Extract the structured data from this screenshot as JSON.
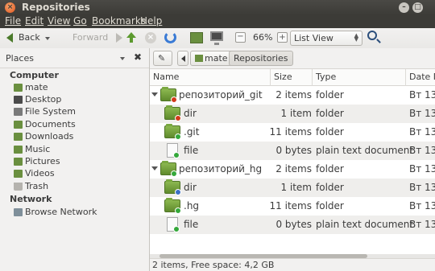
{
  "window": {
    "title": "Repositories"
  },
  "menu": [
    "File",
    "Edit",
    "View",
    "Go",
    "Bookmarks",
    "Help"
  ],
  "toolbar": {
    "back_label": "Back",
    "forward_label": "Forward",
    "zoom_level": "66%",
    "view_mode": "List View"
  },
  "sidebar": {
    "header": "Places",
    "sections": [
      {
        "title": "Computer",
        "items": [
          "mate",
          "Desktop",
          "File System",
          "Documents",
          "Downloads",
          "Music",
          "Pictures",
          "Videos",
          "Trash"
        ]
      },
      {
        "title": "Network",
        "items": [
          "Browse Network"
        ]
      }
    ]
  },
  "pathbar": {
    "crumbs": [
      "mate",
      "Repositories"
    ]
  },
  "columns": [
    "Name",
    "Size",
    "Type",
    "Date M"
  ],
  "rows": [
    {
      "name": "репозиторий_git",
      "size": "2 items",
      "type": "folder",
      "date": "Вт 13",
      "level": 0,
      "expander": "down",
      "icon": "folder",
      "emblem": "red"
    },
    {
      "name": "dir",
      "size": "1 item",
      "type": "folder",
      "date": "Вт 13",
      "level": 1,
      "expander": "right",
      "icon": "folder",
      "emblem": "red"
    },
    {
      "name": ".git",
      "size": "11 items",
      "type": "folder",
      "date": "Вт 13",
      "level": 1,
      "expander": "right",
      "icon": "folder",
      "emblem": "green"
    },
    {
      "name": "file",
      "size": "0 bytes",
      "type": "plain text document",
      "date": "Вт 13",
      "level": 1,
      "expander": "",
      "icon": "file",
      "emblem": "green"
    },
    {
      "name": "репозиторий_hg",
      "size": "2 items",
      "type": "folder",
      "date": "Вт 13",
      "level": 0,
      "expander": "down",
      "icon": "folder",
      "emblem": "green"
    },
    {
      "name": "dir",
      "size": "1 item",
      "type": "folder",
      "date": "Вт 13",
      "level": 1,
      "expander": "right",
      "icon": "folder",
      "emblem": "blue"
    },
    {
      "name": ".hg",
      "size": "11 items",
      "type": "folder",
      "date": "Вт 13",
      "level": 1,
      "expander": "right",
      "icon": "folder",
      "emblem": "green"
    },
    {
      "name": "file",
      "size": "0 bytes",
      "type": "plain text document",
      "date": "Вт 13",
      "level": 1,
      "expander": "",
      "icon": "file",
      "emblem": "green"
    }
  ],
  "status": "2 items, Free space: 4,2 GB",
  "colors": {
    "accent": "#5c9a2e",
    "titlebar": "#3c3b37"
  }
}
